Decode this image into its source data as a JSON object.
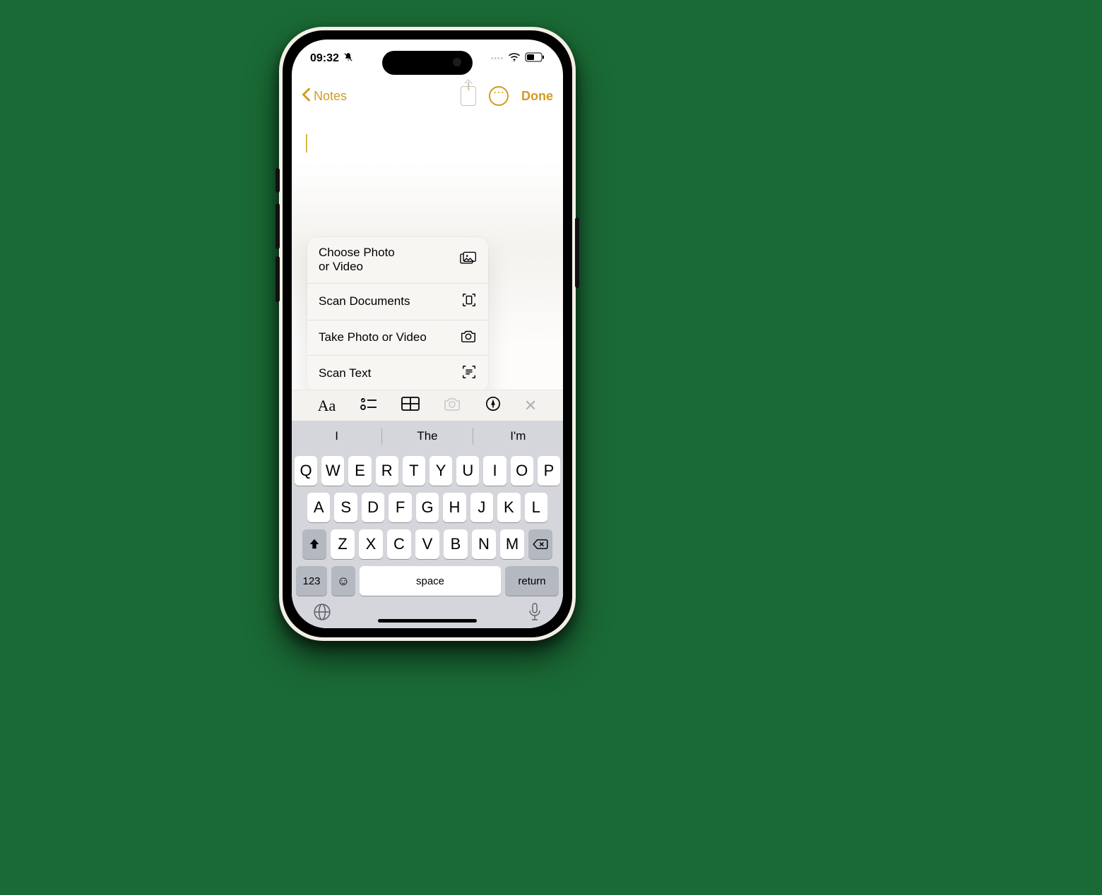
{
  "status": {
    "time": "09:32",
    "silent_icon": "bell-slash-icon"
  },
  "nav": {
    "back_label": "Notes",
    "done_label": "Done"
  },
  "menu": {
    "items": [
      {
        "label": "Choose Photo\nor Video",
        "icon": "photos-icon"
      },
      {
        "label": "Scan Documents",
        "icon": "doc-scan-icon"
      },
      {
        "label": "Take Photo or Video",
        "icon": "camera-icon"
      },
      {
        "label": "Scan Text",
        "icon": "text-scan-icon"
      }
    ]
  },
  "format_bar": {
    "items": [
      "text-style-icon",
      "checklist-icon",
      "table-icon",
      "camera-icon",
      "markup-icon",
      "close-icon"
    ]
  },
  "keyboard": {
    "suggestions": [
      "I",
      "The",
      "I'm"
    ],
    "row1": [
      "Q",
      "W",
      "E",
      "R",
      "T",
      "Y",
      "U",
      "I",
      "O",
      "P"
    ],
    "row2": [
      "A",
      "S",
      "D",
      "F",
      "G",
      "H",
      "J",
      "K",
      "L"
    ],
    "row3": [
      "Z",
      "X",
      "C",
      "V",
      "B",
      "N",
      "M"
    ],
    "numbers_label": "123",
    "space_label": "space",
    "return_label": "return"
  }
}
